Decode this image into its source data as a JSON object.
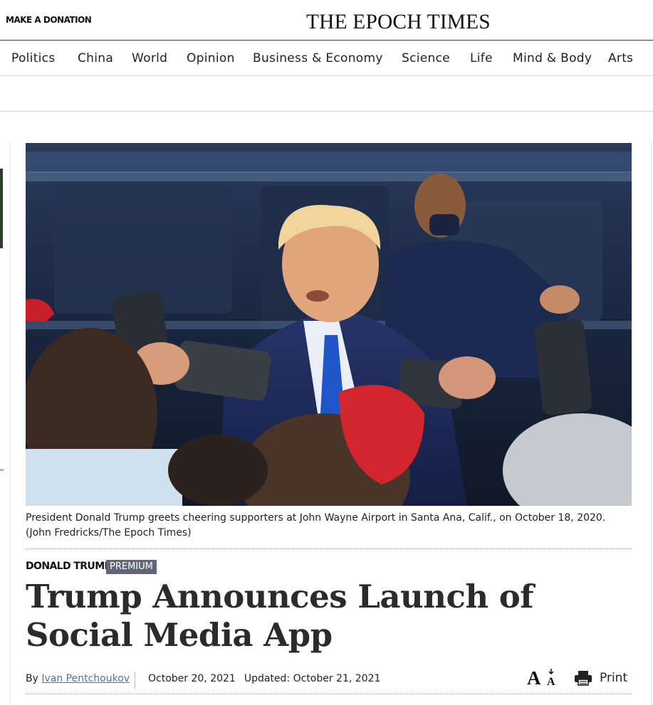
{
  "header": {
    "donate_label": "MAKE A DONATION",
    "masthead": "THE EPOCH TIMES"
  },
  "nav": {
    "items": [
      "Politics",
      "China",
      "World",
      "Opinion",
      "Business & Economy",
      "Science",
      "Life",
      "Mind & Body",
      "Arts"
    ]
  },
  "hero": {
    "caption": "President Donald Trump greets cheering supporters at John Wayne Airport in Santa Ana, Calif., on October 18, 2020. (John Fredricks/The Epoch Times)"
  },
  "article": {
    "category": "DONALD TRUMP",
    "badge": "PREMIUM",
    "title": "Trump Announces Launch of Social Media App",
    "by_prefix": "By",
    "author": "Ivan Pentchoukov",
    "published": "October 20, 2021",
    "updated": "Updated: October 21, 2021"
  },
  "tools": {
    "print_label": "Print",
    "fontsize_icon": "font-size-icon",
    "print_icon": "printer-icon"
  },
  "colors": {
    "badge_bg": "#5f6778",
    "author_link": "#4a74a8",
    "headline": "#2b2b2b"
  }
}
